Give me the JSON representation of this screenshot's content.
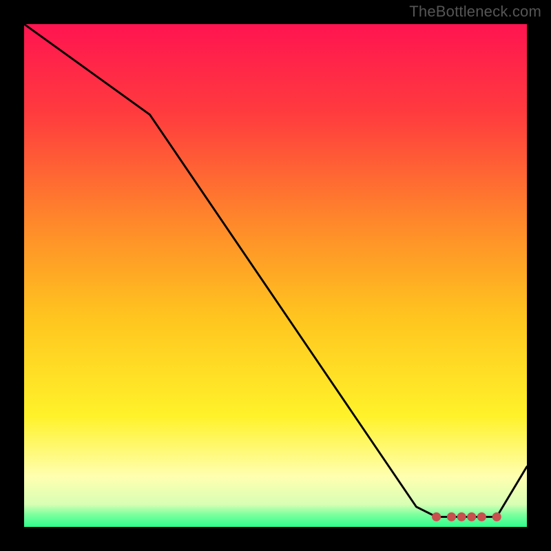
{
  "watermark": "TheBottleneck.com",
  "chart_data": {
    "type": "line",
    "title": "",
    "xlabel": "",
    "ylabel": "",
    "xlim": [
      0,
      100
    ],
    "ylim": [
      0,
      100
    ],
    "x": [
      0,
      25,
      78,
      82,
      86,
      90,
      94,
      100
    ],
    "values": [
      100,
      82,
      4,
      2,
      2,
      2,
      2,
      12
    ],
    "markers": {
      "x": [
        82,
        85,
        87,
        89,
        91,
        94
      ],
      "y": [
        2,
        2,
        2,
        2,
        2,
        2
      ],
      "color": "#c94f4f"
    },
    "gradient_stops": [
      {
        "pos": 0.0,
        "color": "#ff1450"
      },
      {
        "pos": 0.18,
        "color": "#ff3c3e"
      },
      {
        "pos": 0.4,
        "color": "#ff8a2a"
      },
      {
        "pos": 0.58,
        "color": "#ffc41f"
      },
      {
        "pos": 0.78,
        "color": "#fff22a"
      },
      {
        "pos": 0.9,
        "color": "#ffffb0"
      },
      {
        "pos": 0.955,
        "color": "#d8ffb5"
      },
      {
        "pos": 0.975,
        "color": "#7eff9e"
      },
      {
        "pos": 1.0,
        "color": "#2dff8c"
      }
    ]
  }
}
